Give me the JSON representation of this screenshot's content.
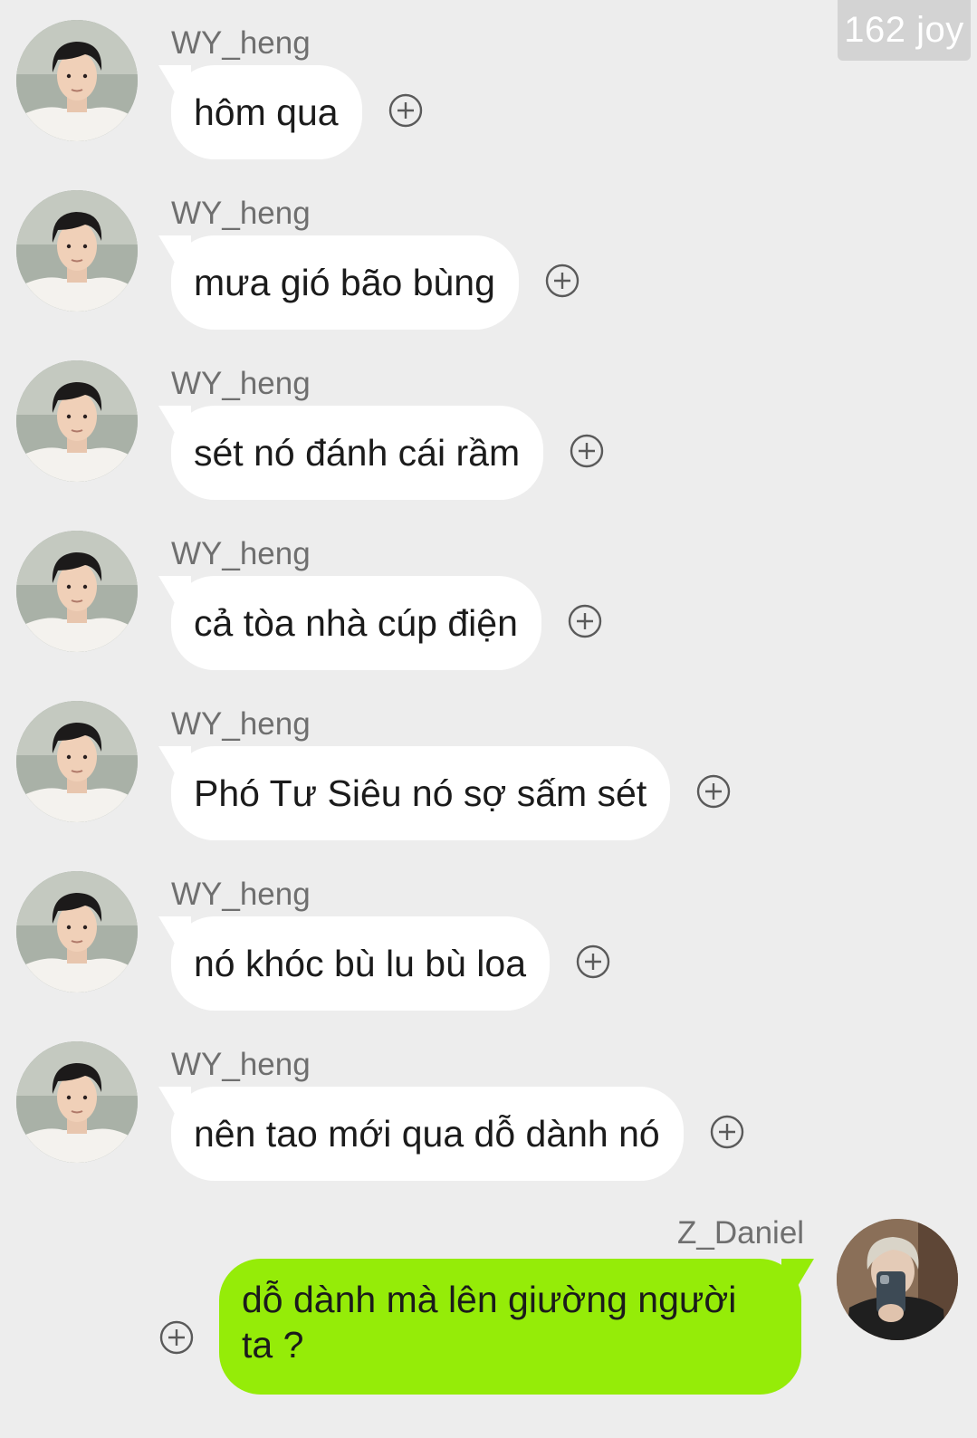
{
  "badge": {
    "text": "162 joy"
  },
  "incoming": {
    "sender": "WY_heng",
    "messages": [
      "hôm qua",
      "mưa gió bão bùng",
      "sét nó đánh cái rầm",
      "cả tòa nhà cúp điện",
      "Phó Tư Siêu nó sợ sấm sét",
      "nó khóc bù lu bù loa",
      "nên tao mới qua dỗ dành nó"
    ]
  },
  "outgoing": {
    "sender": "Z_Daniel",
    "line1": "dỗ dành mà lên giường người",
    "line2": "ta ?"
  },
  "icons": {
    "add": "plus-circle-icon",
    "avatar_in": "avatar-photo-icon",
    "avatar_out": "avatar-photo-icon"
  },
  "colors": {
    "background": "#ededed",
    "incoming_bubble": "#ffffff",
    "outgoing_bubble": "#95ec08",
    "sender_name": "#6f6f6f"
  }
}
